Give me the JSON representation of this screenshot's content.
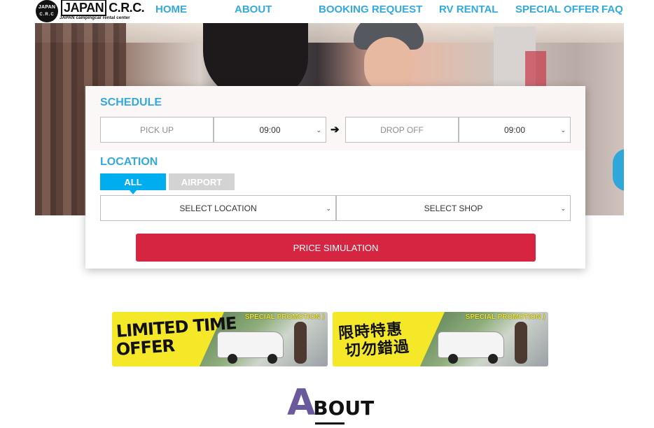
{
  "logo": {
    "badge_top": "JAPAN",
    "badge_bottom": "C.R.C",
    "name_boxed": "JAPAN",
    "name_rest": "C.R.C.",
    "tagline": "JAPAN campingcar rental center"
  },
  "nav": {
    "home": "HOME",
    "about": "ABOUT",
    "booking": "BOOKING REQUEST",
    "rv_rental": "RV RENTAL",
    "special_offer": "SPECIAL OFFER",
    "faq": "FAQ"
  },
  "booking": {
    "schedule_title": "SCHEDULE",
    "pickup_placeholder": "PICK UP",
    "pickup_time": "09:00",
    "arrow": "➔",
    "dropoff_placeholder": "DROP OFF",
    "dropoff_time": "09:00",
    "location_title": "LOCATION",
    "tab_all": "ALL",
    "tab_airport": "AIRPORT",
    "select_location": "SELECT LOCATION",
    "select_shop": "SELECT SHOP",
    "caret": "⌄",
    "submit": "PRICE SIMULATION"
  },
  "banners": [
    {
      "promo": "SPECIAL PROMOTION ⟩",
      "line1": "LIMITED TIME",
      "line2": "OFFER"
    },
    {
      "promo": "SPECIAL PROMOTION ⟩",
      "line1": "限時特惠",
      "line2": "切勿錯過"
    }
  ],
  "about": {
    "cap": "A",
    "rest": "BOUT"
  },
  "colors": {
    "nav": "#33a9dd",
    "section_title": "#33a9dd",
    "tab_active": "#00aeef",
    "tab_inactive": "#d3d3d3",
    "submit": "#d62540",
    "banner_yellow": "#f2e62e",
    "about_cap": "#6a5a9c"
  }
}
